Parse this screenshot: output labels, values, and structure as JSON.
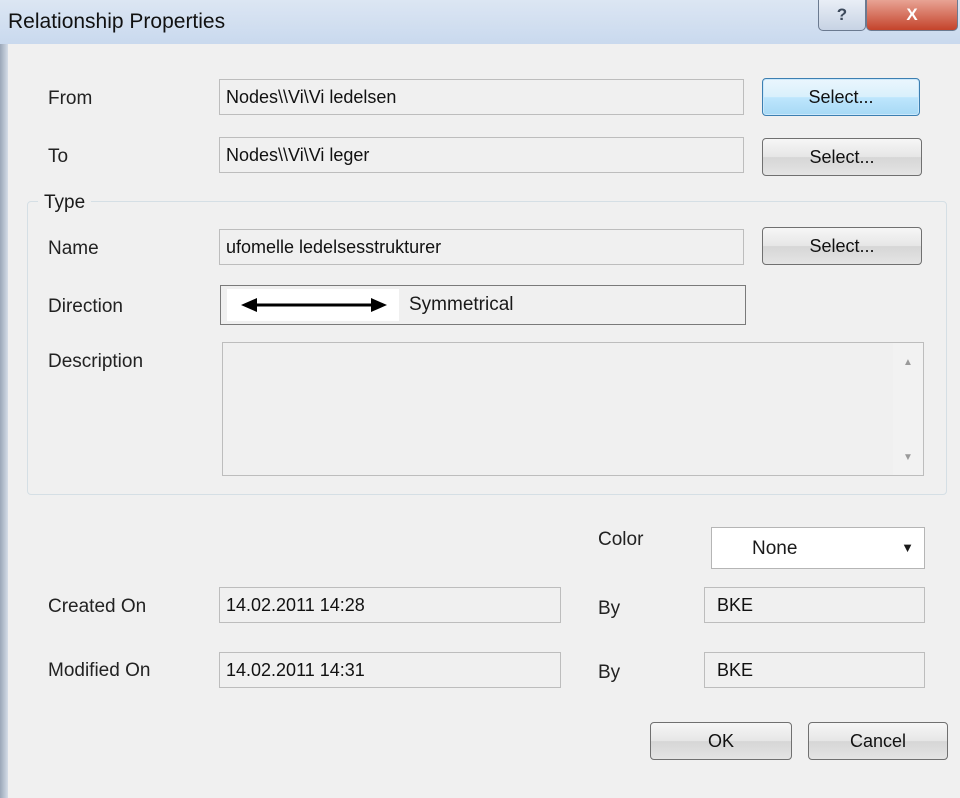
{
  "window": {
    "title": "Relationship Properties",
    "help_glyph": "?",
    "close_glyph": "X"
  },
  "from": {
    "label": "From",
    "value": "Nodes\\\\Vi\\Vi ledelsen",
    "button": "Select..."
  },
  "to": {
    "label": "To",
    "value": "Nodes\\\\Vi\\Vi leger",
    "button": "Select..."
  },
  "type_group": {
    "title": "Type",
    "name": {
      "label": "Name",
      "value": "ufomelle ledelsesstrukturer",
      "button": "Select..."
    },
    "direction": {
      "label": "Direction",
      "value": "Symmetrical",
      "icon": "double-arrow-icon"
    },
    "description": {
      "label": "Description",
      "value": ""
    }
  },
  "color": {
    "label": "Color",
    "selected": "None"
  },
  "created": {
    "label": "Created On",
    "value": "14.02.2011 14:28",
    "by_label": "By",
    "by_value": "BKE"
  },
  "modified": {
    "label": "Modified On",
    "value": "14.02.2011 14:31",
    "by_label": "By",
    "by_value": "BKE"
  },
  "actions": {
    "ok": "OK",
    "cancel": "Cancel"
  }
}
